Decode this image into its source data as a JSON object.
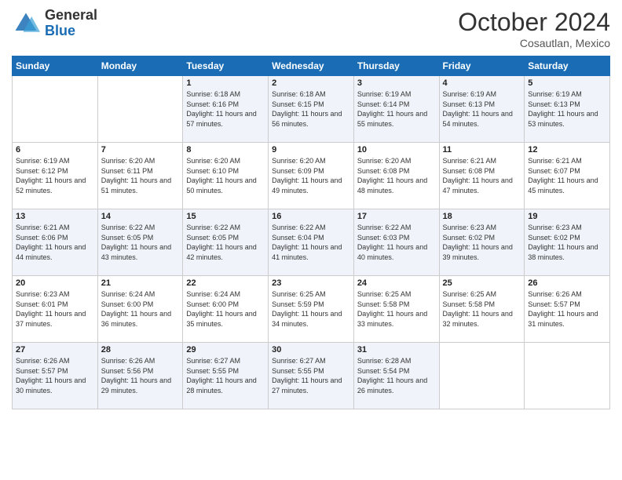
{
  "header": {
    "logo_general": "General",
    "logo_blue": "Blue",
    "month_title": "October 2024",
    "subtitle": "Cosautlan, Mexico"
  },
  "days_of_week": [
    "Sunday",
    "Monday",
    "Tuesday",
    "Wednesday",
    "Thursday",
    "Friday",
    "Saturday"
  ],
  "weeks": [
    [
      {
        "day": "",
        "info": ""
      },
      {
        "day": "",
        "info": ""
      },
      {
        "day": "1",
        "info": "Sunrise: 6:18 AM\nSunset: 6:16 PM\nDaylight: 11 hours and 57 minutes."
      },
      {
        "day": "2",
        "info": "Sunrise: 6:18 AM\nSunset: 6:15 PM\nDaylight: 11 hours and 56 minutes."
      },
      {
        "day": "3",
        "info": "Sunrise: 6:19 AM\nSunset: 6:14 PM\nDaylight: 11 hours and 55 minutes."
      },
      {
        "day": "4",
        "info": "Sunrise: 6:19 AM\nSunset: 6:13 PM\nDaylight: 11 hours and 54 minutes."
      },
      {
        "day": "5",
        "info": "Sunrise: 6:19 AM\nSunset: 6:13 PM\nDaylight: 11 hours and 53 minutes."
      }
    ],
    [
      {
        "day": "6",
        "info": "Sunrise: 6:19 AM\nSunset: 6:12 PM\nDaylight: 11 hours and 52 minutes."
      },
      {
        "day": "7",
        "info": "Sunrise: 6:20 AM\nSunset: 6:11 PM\nDaylight: 11 hours and 51 minutes."
      },
      {
        "day": "8",
        "info": "Sunrise: 6:20 AM\nSunset: 6:10 PM\nDaylight: 11 hours and 50 minutes."
      },
      {
        "day": "9",
        "info": "Sunrise: 6:20 AM\nSunset: 6:09 PM\nDaylight: 11 hours and 49 minutes."
      },
      {
        "day": "10",
        "info": "Sunrise: 6:20 AM\nSunset: 6:08 PM\nDaylight: 11 hours and 48 minutes."
      },
      {
        "day": "11",
        "info": "Sunrise: 6:21 AM\nSunset: 6:08 PM\nDaylight: 11 hours and 47 minutes."
      },
      {
        "day": "12",
        "info": "Sunrise: 6:21 AM\nSunset: 6:07 PM\nDaylight: 11 hours and 45 minutes."
      }
    ],
    [
      {
        "day": "13",
        "info": "Sunrise: 6:21 AM\nSunset: 6:06 PM\nDaylight: 11 hours and 44 minutes."
      },
      {
        "day": "14",
        "info": "Sunrise: 6:22 AM\nSunset: 6:05 PM\nDaylight: 11 hours and 43 minutes."
      },
      {
        "day": "15",
        "info": "Sunrise: 6:22 AM\nSunset: 6:05 PM\nDaylight: 11 hours and 42 minutes."
      },
      {
        "day": "16",
        "info": "Sunrise: 6:22 AM\nSunset: 6:04 PM\nDaylight: 11 hours and 41 minutes."
      },
      {
        "day": "17",
        "info": "Sunrise: 6:22 AM\nSunset: 6:03 PM\nDaylight: 11 hours and 40 minutes."
      },
      {
        "day": "18",
        "info": "Sunrise: 6:23 AM\nSunset: 6:02 PM\nDaylight: 11 hours and 39 minutes."
      },
      {
        "day": "19",
        "info": "Sunrise: 6:23 AM\nSunset: 6:02 PM\nDaylight: 11 hours and 38 minutes."
      }
    ],
    [
      {
        "day": "20",
        "info": "Sunrise: 6:23 AM\nSunset: 6:01 PM\nDaylight: 11 hours and 37 minutes."
      },
      {
        "day": "21",
        "info": "Sunrise: 6:24 AM\nSunset: 6:00 PM\nDaylight: 11 hours and 36 minutes."
      },
      {
        "day": "22",
        "info": "Sunrise: 6:24 AM\nSunset: 6:00 PM\nDaylight: 11 hours and 35 minutes."
      },
      {
        "day": "23",
        "info": "Sunrise: 6:25 AM\nSunset: 5:59 PM\nDaylight: 11 hours and 34 minutes."
      },
      {
        "day": "24",
        "info": "Sunrise: 6:25 AM\nSunset: 5:58 PM\nDaylight: 11 hours and 33 minutes."
      },
      {
        "day": "25",
        "info": "Sunrise: 6:25 AM\nSunset: 5:58 PM\nDaylight: 11 hours and 32 minutes."
      },
      {
        "day": "26",
        "info": "Sunrise: 6:26 AM\nSunset: 5:57 PM\nDaylight: 11 hours and 31 minutes."
      }
    ],
    [
      {
        "day": "27",
        "info": "Sunrise: 6:26 AM\nSunset: 5:57 PM\nDaylight: 11 hours and 30 minutes."
      },
      {
        "day": "28",
        "info": "Sunrise: 6:26 AM\nSunset: 5:56 PM\nDaylight: 11 hours and 29 minutes."
      },
      {
        "day": "29",
        "info": "Sunrise: 6:27 AM\nSunset: 5:55 PM\nDaylight: 11 hours and 28 minutes."
      },
      {
        "day": "30",
        "info": "Sunrise: 6:27 AM\nSunset: 5:55 PM\nDaylight: 11 hours and 27 minutes."
      },
      {
        "day": "31",
        "info": "Sunrise: 6:28 AM\nSunset: 5:54 PM\nDaylight: 11 hours and 26 minutes."
      },
      {
        "day": "",
        "info": ""
      },
      {
        "day": "",
        "info": ""
      }
    ]
  ]
}
